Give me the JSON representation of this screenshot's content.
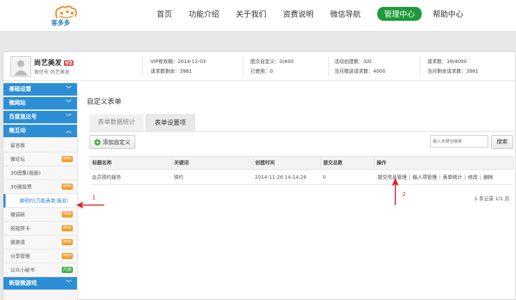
{
  "brand": {
    "name": "客多多"
  },
  "nav": {
    "items": [
      "首页",
      "功能介绍",
      "关于我们",
      "资费说明",
      "微信导航",
      "管理中心",
      "帮助中心"
    ],
    "active_index": 5
  },
  "account": {
    "name": "尚艺美发",
    "badge": "V2",
    "wechat": "微信号:尚艺美发"
  },
  "stats": {
    "vip_expire": "VIP有效期：2014-12-03",
    "requests_left": "请求数剩余：3981",
    "custom_graphic": "图文自定义：0/400",
    "used": "已使用：0",
    "activities": "活动创建数：0/0",
    "monthly_sent": "当月赠送请求数：4000",
    "requests": "请求数：19/4000",
    "monthly_left": "当月剩余请求数：3981"
  },
  "sidebar": {
    "sections": [
      {
        "label": "基础设置",
        "chevron": "﹀"
      },
      {
        "label": "微网站",
        "chevron": "﹀"
      },
      {
        "label": "百度直达号",
        "chevron": "﹀"
      },
      {
        "label": "微互动",
        "chevron": "︿"
      }
    ],
    "items": [
      {
        "label": "留言板",
        "tag": ""
      },
      {
        "label": "微论坛",
        "tag": "NEW"
      },
      {
        "label": "3G图集(相册)",
        "tag": ""
      },
      {
        "label": "3G微投票",
        "tag": "NEW"
      },
      {
        "label": "微预约(万能表单,报名)",
        "tag": "",
        "active": true
      },
      {
        "label": "微调研",
        "tag": "NEW"
      },
      {
        "label": "祝福贺卡",
        "tag": "NEW"
      },
      {
        "label": "微邀请",
        "tag": "NEW"
      },
      {
        "label": "分享管理",
        "tag": "NEW"
      },
      {
        "label": "公众小秘书",
        "tag": "内测"
      }
    ],
    "last_section": {
      "label": "新版微游戏",
      "chevron": "﹀"
    }
  },
  "main": {
    "title": "自定义表单",
    "tabs": [
      "表单数据统计",
      "表单设置项"
    ],
    "active_tab": 1,
    "add_button": "添加自定义",
    "search_placeholder": "输入关键词搜索",
    "search_button": "搜索",
    "table": {
      "columns": [
        "标题名称",
        "关键词",
        "创建时间",
        "提交总数",
        "操作"
      ],
      "rows": [
        {
          "title": "会员预约服务",
          "keyword": "预约",
          "created": "2014-11-26 14:14:26",
          "count": "0",
          "ops": [
            "提交信息管理",
            "输入项管理",
            "表单统计",
            "修改",
            "删除"
          ]
        }
      ]
    },
    "pager": "1 条记录 1/1 页"
  },
  "annotations": {
    "label1": "1",
    "label2": "2",
    "color": "#e02020"
  }
}
